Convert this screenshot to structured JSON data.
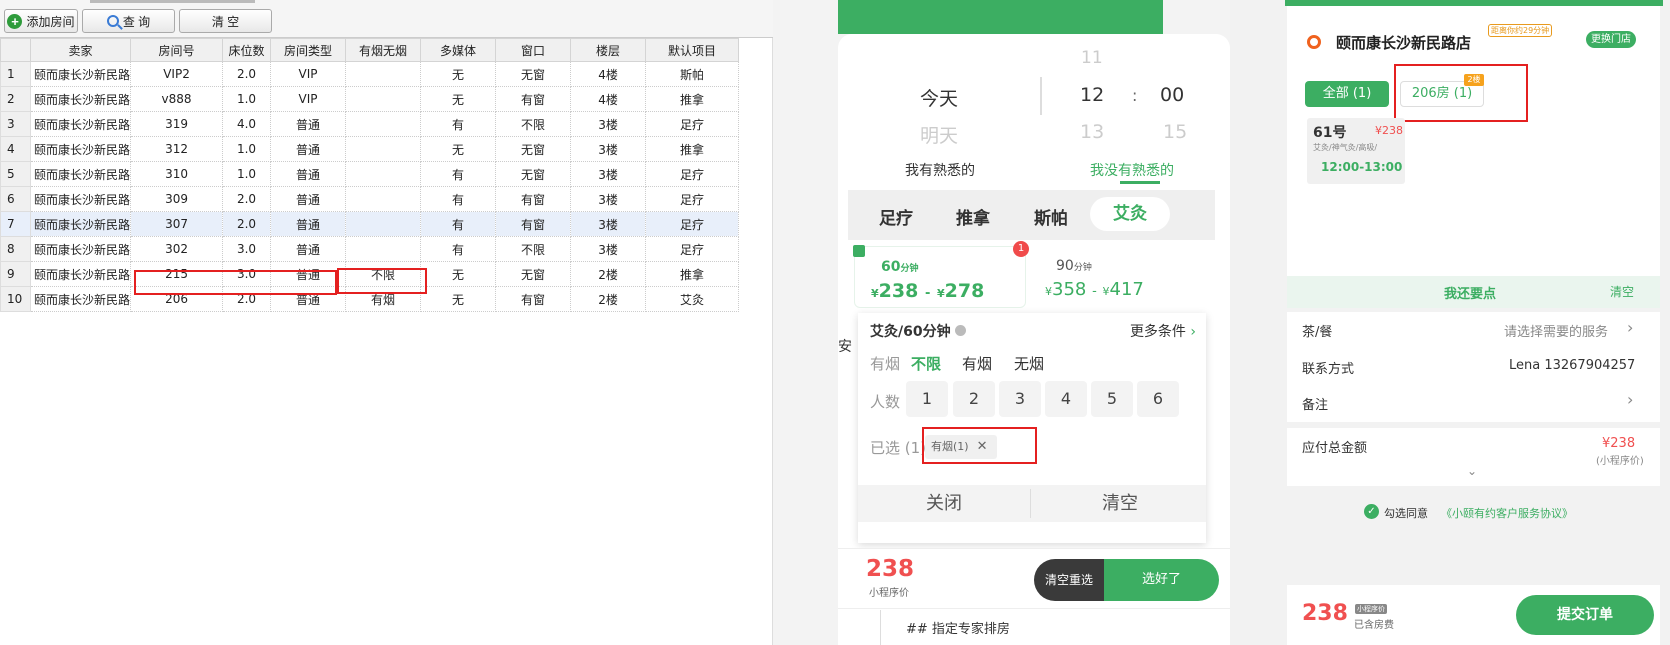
{
  "left": {
    "toolbar": {
      "add_room": "添加房间",
      "query": "查 询",
      "clear": "清 空"
    },
    "columns": [
      "卖家",
      "房间号",
      "床位数",
      "房间类型",
      "有烟无烟",
      "多媒体",
      "窗口",
      "楼层",
      "默认项目"
    ],
    "rows": [
      {
        "n": "1",
        "seller": "颐而康长沙新民路",
        "room": "VIP2",
        "beds": "2.0",
        "type": "VIP",
        "smoke": "",
        "media": "无",
        "window": "无窗",
        "floor": "4楼",
        "item": "斯帕"
      },
      {
        "n": "2",
        "seller": "颐而康长沙新民路",
        "room": "v888",
        "beds": "1.0",
        "type": "VIP",
        "smoke": "",
        "media": "无",
        "window": "有窗",
        "floor": "4楼",
        "item": "推拿"
      },
      {
        "n": "3",
        "seller": "颐而康长沙新民路",
        "room": "319",
        "beds": "4.0",
        "type": "普通",
        "smoke": "",
        "media": "有",
        "window": "不限",
        "floor": "3楼",
        "item": "足疗"
      },
      {
        "n": "4",
        "seller": "颐而康长沙新民路",
        "room": "312",
        "beds": "1.0",
        "type": "普通",
        "smoke": "",
        "media": "无",
        "window": "无窗",
        "floor": "3楼",
        "item": "推拿"
      },
      {
        "n": "5",
        "seller": "颐而康长沙新民路",
        "room": "310",
        "beds": "1.0",
        "type": "普通",
        "smoke": "",
        "media": "有",
        "window": "无窗",
        "floor": "3楼",
        "item": "足疗"
      },
      {
        "n": "6",
        "seller": "颐而康长沙新民路",
        "room": "309",
        "beds": "2.0",
        "type": "普通",
        "smoke": "",
        "media": "有",
        "window": "有窗",
        "floor": "3楼",
        "item": "足疗"
      },
      {
        "n": "7",
        "seller": "颐而康长沙新民路",
        "room": "307",
        "beds": "2.0",
        "type": "普通",
        "smoke": "",
        "media": "有",
        "window": "有窗",
        "floor": "3楼",
        "item": "足疗"
      },
      {
        "n": "8",
        "seller": "颐而康长沙新民路",
        "room": "302",
        "beds": "3.0",
        "type": "普通",
        "smoke": "",
        "media": "有",
        "window": "不限",
        "floor": "3楼",
        "item": "足疗"
      },
      {
        "n": "9",
        "seller": "颐而康长沙新民路",
        "room": "215",
        "beds": "3.0",
        "type": "普通",
        "smoke": "不限",
        "media": "无",
        "window": "无窗",
        "floor": "2楼",
        "item": "推拿"
      },
      {
        "n": "10",
        "seller": "颐而康长沙新民路",
        "room": "206",
        "beds": "2.0",
        "type": "普通",
        "smoke": "有烟",
        "media": "无",
        "window": "有窗",
        "floor": "2楼",
        "item": "艾灸"
      }
    ]
  },
  "mid": {
    "picker": {
      "day_selected": "今天",
      "day_next": "明天",
      "hour_prev": "11",
      "hour_selected": "12",
      "hour_next": "13",
      "colon": ":",
      "min_selected": "00",
      "min_next": "15"
    },
    "tabs": {
      "familiar": "我有熟悉的",
      "not_familiar": "我没有熟悉的"
    },
    "services": [
      "足疗",
      "推拿",
      "斯帕",
      "艾灸"
    ],
    "card1": {
      "duration": "60",
      "unit": "分钟",
      "price_from": "238",
      "price_to": "278",
      "badge": "1",
      "currency": "¥"
    },
    "card2": {
      "duration": "90",
      "unit": "分钟",
      "price_from": "358",
      "price_to": "417",
      "currency": "¥"
    },
    "side_text": "安",
    "filter": {
      "title": "艾灸/60分钟",
      "more": "更多条件",
      "smoke_label": "有烟",
      "smoke_options": [
        "不限",
        "有烟",
        "无烟"
      ],
      "people_label": "人数",
      "people_options": [
        "1",
        "2",
        "3",
        "4",
        "5",
        "6"
      ],
      "selected_label": "已选 (1)",
      "selected_tag": "有烟(1)",
      "close": "关闭",
      "clear": "清空"
    },
    "bottom": {
      "price": "238",
      "price_label": "小程序价",
      "reset": "清空重选",
      "done": "选好了"
    },
    "footer_text": "## 指定专家排房"
  },
  "right": {
    "store_name": "颐而康长沙新民路店",
    "distance_tag": "距离你约29分钟",
    "change_store": "更换门店",
    "room_tabs": {
      "all": "全部 (1)",
      "room": "206房 (1)",
      "floor_badge": "2楼"
    },
    "tech": {
      "number": "61号",
      "price": "¥238",
      "skills": "艾灸/神气灸/高吸/",
      "time": "12:00-13:00"
    },
    "also_want": "我还要点",
    "clear": "清空",
    "rows": [
      {
        "label": "茶/餐",
        "value": "请选择需要的服务"
      },
      {
        "label": "联系方式",
        "value": "Lena 13267904257"
      },
      {
        "label": "备注",
        "value": ""
      }
    ],
    "total": {
      "label": "应付总金额",
      "price": "¥238",
      "sub": "(小程序价)"
    },
    "agree": {
      "prefix": "勾选同意",
      "link": "《小颐有约客户服务协议》"
    },
    "bottom": {
      "price": "238",
      "badge": "小程序价",
      "note": "已含房费",
      "submit": "提交订单"
    }
  }
}
